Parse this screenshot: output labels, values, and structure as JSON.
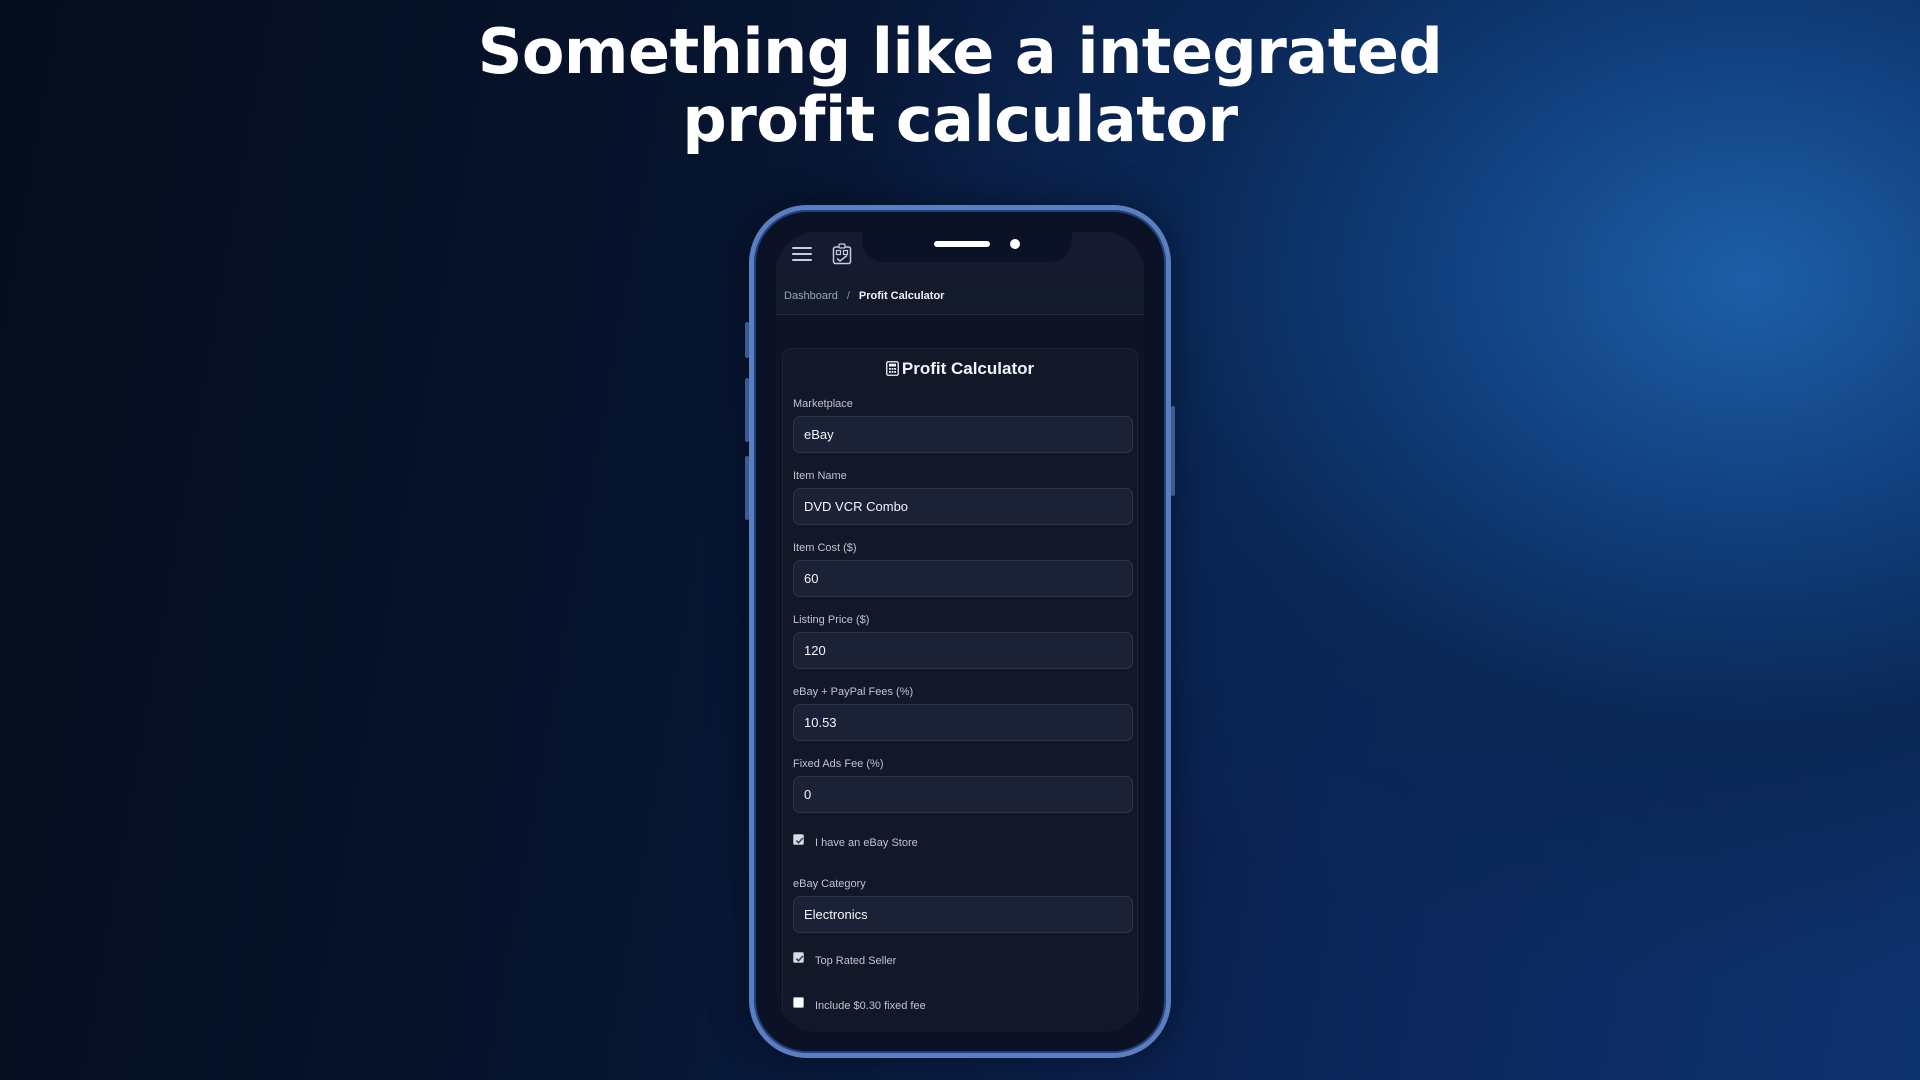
{
  "headline": {
    "line1": "Something like a integrated",
    "line2": "profit calculator"
  },
  "icons": {
    "menu": "hamburger-menu-icon",
    "app": "qr-checklist-icon",
    "calculator": "calculator-icon",
    "check": "checkmark-icon"
  },
  "breadcrumb": {
    "home": "Dashboard",
    "separator": "/",
    "current": "Profit Calculator"
  },
  "calculator": {
    "title": "Profit Calculator",
    "fields": [
      {
        "label": "Marketplace",
        "value": "eBay"
      },
      {
        "label": "Item Name",
        "value": "DVD VCR Combo"
      },
      {
        "label": "Item Cost ($)",
        "value": "60"
      },
      {
        "label": "Listing Price ($)",
        "value": "120"
      },
      {
        "label": "eBay + PayPal Fees (%)",
        "value": "10.53"
      },
      {
        "label": "Fixed Ads Fee (%)",
        "value": "0"
      }
    ],
    "ebay_store": {
      "label": "I have an eBay Store",
      "checked": true
    },
    "category": {
      "label": "eBay Category",
      "value": "Electronics"
    },
    "top_rated": {
      "label": "Top Rated Seller",
      "checked": true
    },
    "fixed_fee": {
      "label": "Include $0.30 fixed fee",
      "checked": false
    }
  },
  "colors": {
    "background": "#07142e",
    "phone_frame": "#5a7fc0",
    "screen": "#0f1424",
    "field_bg": "#1b2236",
    "text": "#f2f5fb"
  }
}
